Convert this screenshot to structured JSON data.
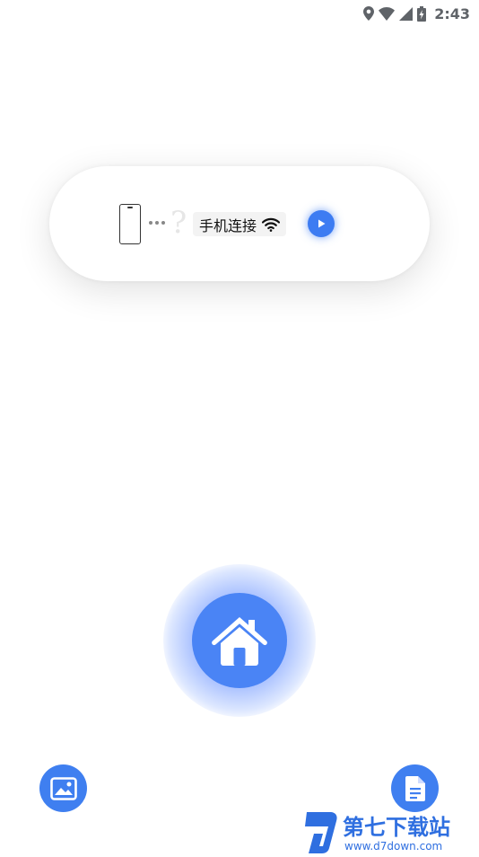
{
  "status_bar": {
    "time": "2:43",
    "icons": [
      "location-icon",
      "wifi-icon",
      "signal-icon",
      "battery-charging-icon"
    ]
  },
  "connection_card": {
    "label": "手机连接",
    "icons": [
      "phone-outline-icon",
      "question-mark-icon",
      "wifi-icon",
      "play-icon"
    ]
  },
  "home_button": {
    "icon": "home-icon"
  },
  "bottom_actions": {
    "left_icon": "gallery-icon",
    "right_icon": "document-icon"
  },
  "watermark": {
    "text": "第七下载站",
    "url": "www.d7down.com"
  },
  "colors": {
    "accent": "#4a84f5",
    "glow": "#7fa2ff",
    "status_icons": "#5f6368"
  }
}
